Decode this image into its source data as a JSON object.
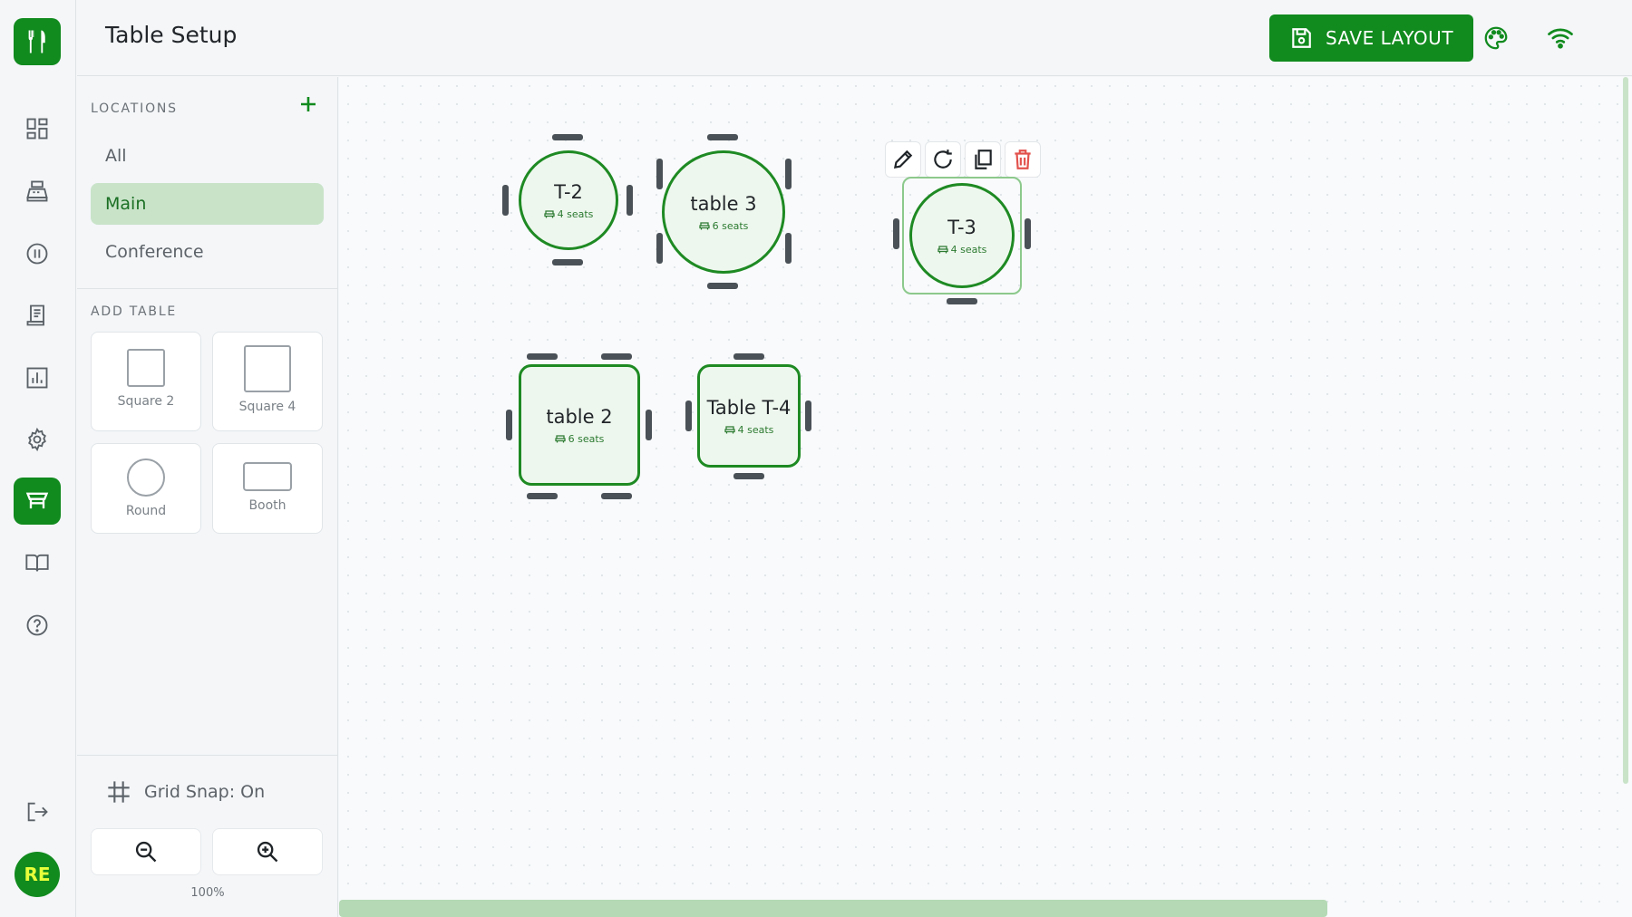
{
  "app": {
    "brand_icon": "fork-knife-icon",
    "accent_color": "#118a1e",
    "user_initials": "RE"
  },
  "rail": {
    "items": [
      {
        "name": "dashboard",
        "icon": "dashboard-icon"
      },
      {
        "name": "pos",
        "icon": "register-icon"
      },
      {
        "name": "orders",
        "icon": "pause-icon"
      },
      {
        "name": "receipts",
        "icon": "receipt-icon"
      },
      {
        "name": "reports",
        "icon": "bar-chart-icon"
      },
      {
        "name": "settings",
        "icon": "gear-icon"
      },
      {
        "name": "tables",
        "icon": "table-icon",
        "active": true
      },
      {
        "name": "menu",
        "icon": "book-icon"
      },
      {
        "name": "help",
        "icon": "help-icon"
      },
      {
        "name": "logout",
        "icon": "logout-icon"
      }
    ]
  },
  "header": {
    "title": "Table Setup",
    "save_label": "SAVE LAYOUT"
  },
  "sidebar": {
    "locations_label": "LOCATIONS",
    "locations": [
      {
        "label": "All"
      },
      {
        "label": "Main",
        "selected": true
      },
      {
        "label": "Conference"
      }
    ],
    "add_table_label": "ADD TABLE",
    "shapes": [
      {
        "label": "Square 2"
      },
      {
        "label": "Square 4"
      },
      {
        "label": "Round"
      },
      {
        "label": "Booth"
      }
    ],
    "grid_snap": "Grid Snap: On",
    "zoom": "100%"
  },
  "canvas": {
    "tables": [
      {
        "name": "T-2",
        "seats": "4 seats"
      },
      {
        "name": "table 3",
        "seats": "6 seats"
      },
      {
        "name": "T-3",
        "seats": "4 seats",
        "selected": true
      },
      {
        "name": "table 2",
        "seats": "6 seats"
      },
      {
        "name": "Table T-4",
        "seats": "4 seats"
      }
    ],
    "toolbar": [
      "pencil-icon",
      "rotate-icon",
      "copy-icon",
      "trash-icon"
    ]
  }
}
